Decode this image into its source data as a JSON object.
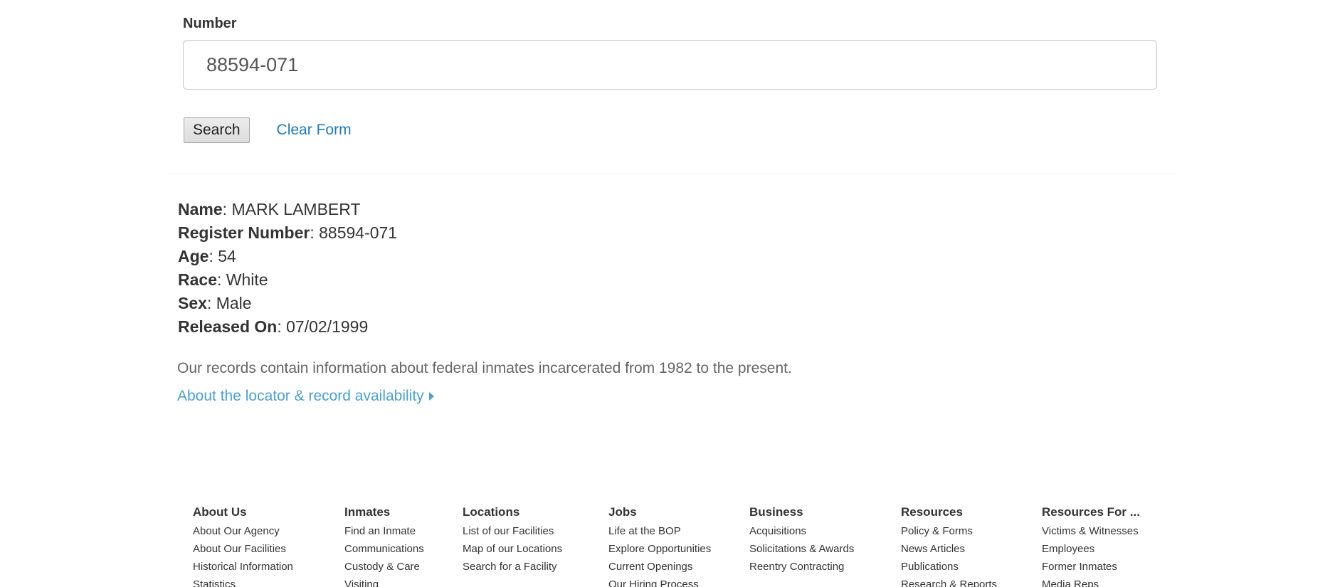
{
  "form": {
    "number_label": "Number",
    "number_value": "88594-071",
    "search_label": "Search",
    "clear_label": "Clear Form"
  },
  "result": {
    "name_label": "Name",
    "name_value": "MARK LAMBERT",
    "register_label": "Register Number",
    "register_value": "88594-071",
    "age_label": "Age",
    "age_value": "54",
    "race_label": "Race",
    "race_value": "White",
    "sex_label": "Sex",
    "sex_value": "Male",
    "released_label": "Released On",
    "released_value": "07/02/1999"
  },
  "info": {
    "note": "Our records contain information about federal inmates incarcerated from 1982 to the present.",
    "about_link": "About the locator & record availability"
  },
  "footer": {
    "columns": [
      {
        "heading": "About Us",
        "links": [
          "About Our Agency",
          "About Our Facilities",
          "Historical Information",
          "Statistics"
        ]
      },
      {
        "heading": "Inmates",
        "links": [
          "Find an Inmate",
          "Communications",
          "Custody & Care",
          "Visiting"
        ]
      },
      {
        "heading": "Locations",
        "links": [
          "List of our Facilities",
          "Map of our Locations",
          "Search for a Facility"
        ]
      },
      {
        "heading": "Jobs",
        "links": [
          "Life at the BOP",
          "Explore Opportunities",
          "Current Openings",
          "Our Hiring Process"
        ]
      },
      {
        "heading": "Business",
        "links": [
          "Acquisitions",
          "Solicitations & Awards",
          "Reentry Contracting"
        ]
      },
      {
        "heading": "Resources",
        "links": [
          "Policy & Forms",
          "News Articles",
          "Publications",
          "Research & Reports"
        ]
      },
      {
        "heading": "Resources For ...",
        "links": [
          "Victims & Witnesses",
          "Employees",
          "Former Inmates",
          "Media Reps"
        ]
      }
    ]
  },
  "colors": {
    "link": "#1a7bc2",
    "link_light": "#4aa0d5",
    "text": "#333333",
    "muted": "#666666"
  }
}
